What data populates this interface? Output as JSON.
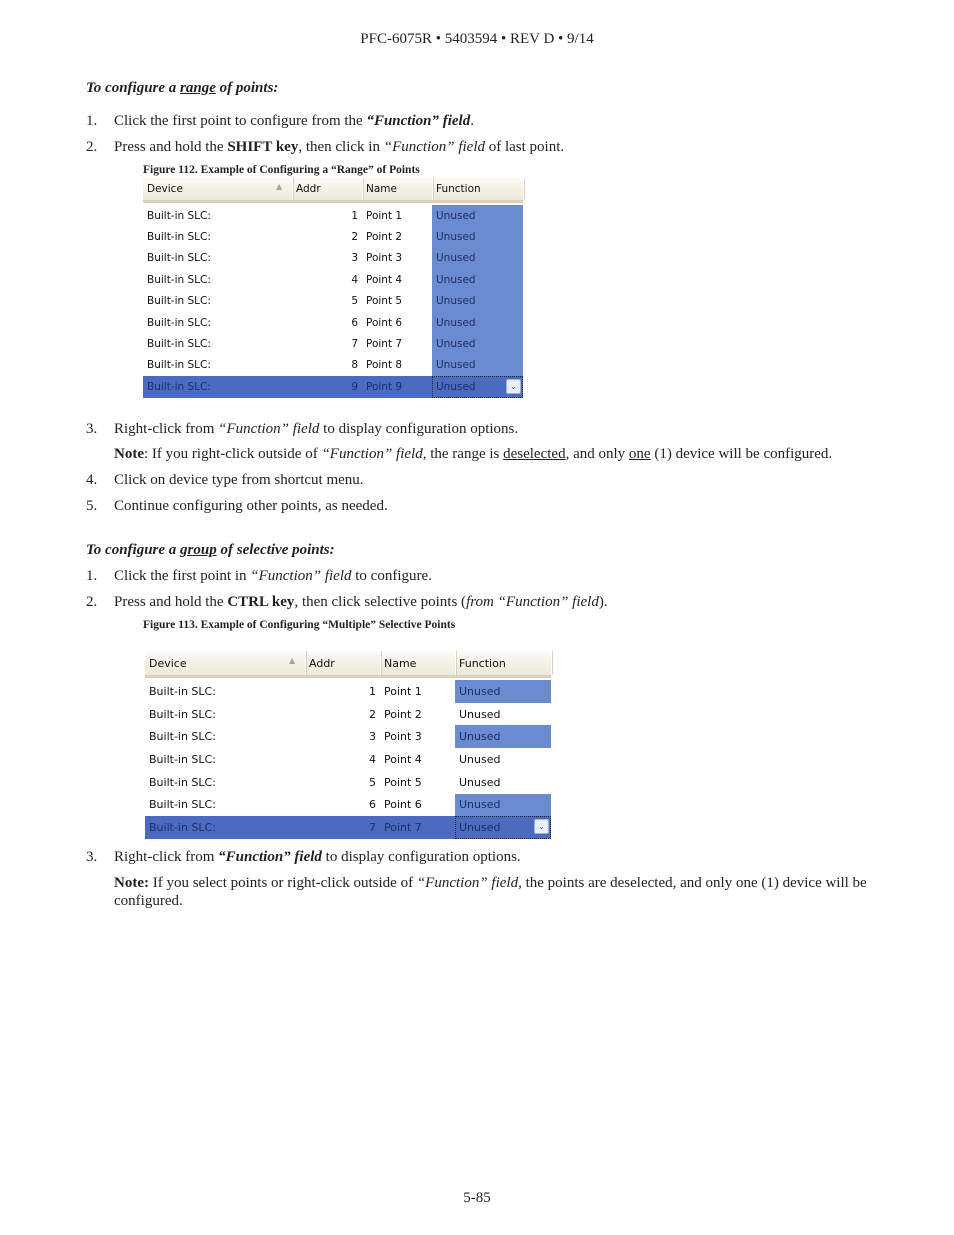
{
  "header": "PFC-6075R • 5403594 • REV D • 9/14",
  "footer": "5-85",
  "section1": {
    "heading": [
      {
        "t": "To configure a ",
        "s": "bi"
      },
      {
        "t": "range",
        "s": "biu"
      },
      {
        "t": " of points:",
        "s": "bi"
      }
    ],
    "steps": [
      {
        "n": "1.",
        "parts": [
          {
            "t": "Click the first point to configure from the ",
            "s": ""
          },
          {
            "t": "“Function” field",
            "s": "bi"
          },
          {
            "t": ".",
            "s": ""
          }
        ]
      },
      {
        "n": "2.",
        "parts": [
          {
            "t": "Press and hold the ",
            "s": ""
          },
          {
            "t": "SHIFT key",
            "s": "b"
          },
          {
            "t": ", then click in ",
            "s": ""
          },
          {
            "t": "“Function” field",
            "s": "i"
          },
          {
            "t": " of last point.",
            "s": ""
          }
        ]
      }
    ],
    "figure_caption": "Figure 112. Example of Configuring a “Range” of Points",
    "steps2": [
      {
        "n": "3.",
        "parts": [
          {
            "t": "Right-click from ",
            "s": ""
          },
          {
            "t": "“Function” field",
            "s": "i"
          },
          {
            "t": " to display configuration options.",
            "s": ""
          }
        ]
      },
      {
        "n": "",
        "parts": [
          {
            "t": "Note",
            "s": "b"
          },
          {
            "t": ": If you right-click outside of ",
            "s": ""
          },
          {
            "t": "“Function” field,",
            "s": "i"
          },
          {
            "t": " the range is ",
            "s": ""
          },
          {
            "t": "deselected",
            "s": "u"
          },
          {
            "t": ", and only ",
            "s": ""
          },
          {
            "t": "one",
            "s": "u"
          },
          {
            "t": " (1) device will be configured.",
            "s": ""
          }
        ]
      },
      {
        "n": "4.",
        "parts": [
          {
            "t": "Click on device type from shortcut menu.",
            "s": ""
          }
        ]
      },
      {
        "n": "5.",
        "parts": [
          {
            "t": "Continue configuring other points, as needed.",
            "s": ""
          }
        ]
      }
    ]
  },
  "section2": {
    "heading": [
      {
        "t": "To configure a ",
        "s": "bi"
      },
      {
        "t": "group",
        "s": "biu"
      },
      {
        "t": " of selective points:",
        "s": "bi"
      }
    ],
    "steps": [
      {
        "n": "1.",
        "parts": [
          {
            "t": "Click the first point in ",
            "s": ""
          },
          {
            "t": "“Function” field",
            "s": "i"
          },
          {
            "t": " to configure.",
            "s": ""
          }
        ]
      },
      {
        "n": "2.",
        "parts": [
          {
            "t": "Press and hold the ",
            "s": ""
          },
          {
            "t": "CTRL key",
            "s": "b"
          },
          {
            "t": ", then click selective points (",
            "s": ""
          },
          {
            "t": "from “Function” field",
            "s": "i"
          },
          {
            "t": ").",
            "s": ""
          }
        ]
      }
    ],
    "figure_caption": "Figure 113. Example of Configuring “Multiple” Selective Points",
    "steps2": [
      {
        "n": "3.",
        "parts": [
          {
            "t": "Right-click from ",
            "s": ""
          },
          {
            "t": "“Function” field",
            "s": "bi"
          },
          {
            "t": " to display configuration options.",
            "s": ""
          }
        ]
      }
    ],
    "note_line1": [
      {
        "t": "Note:",
        "s": "b"
      },
      {
        "t": " If you select points or right-click outside of ",
        "s": ""
      },
      {
        "t": "“Function” field,",
        "s": "i"
      },
      {
        "t": " the points are deselected, and only one (1) device will be",
        "s": ""
      }
    ],
    "note_line2": [
      {
        "t": "configured.",
        "s": ""
      }
    ]
  },
  "grid1": {
    "columns": [
      "Device",
      "Addr",
      "Name",
      "Function"
    ],
    "sort_icon": "triangle-up-icon",
    "rows": [
      {
        "device": "Built-in SLC:",
        "addr": "1",
        "name": "Point 1",
        "function": "Unused",
        "highlighted": true,
        "selected": false
      },
      {
        "device": "Built-in SLC:",
        "addr": "2",
        "name": "Point 2",
        "function": "Unused",
        "highlighted": true,
        "selected": false
      },
      {
        "device": "Built-in SLC:",
        "addr": "3",
        "name": "Point 3",
        "function": "Unused",
        "highlighted": true,
        "selected": false
      },
      {
        "device": "Built-in SLC:",
        "addr": "4",
        "name": "Point 4",
        "function": "Unused",
        "highlighted": true,
        "selected": false
      },
      {
        "device": "Built-in SLC:",
        "addr": "5",
        "name": "Point 5",
        "function": "Unused",
        "highlighted": true,
        "selected": false
      },
      {
        "device": "Built-in SLC:",
        "addr": "6",
        "name": "Point 6",
        "function": "Unused",
        "highlighted": true,
        "selected": false
      },
      {
        "device": "Built-in SLC:",
        "addr": "7",
        "name": "Point 7",
        "function": "Unused",
        "highlighted": true,
        "selected": false
      },
      {
        "device": "Built-in SLC:",
        "addr": "8",
        "name": "Point 8",
        "function": "Unused",
        "highlighted": true,
        "selected": false
      },
      {
        "device": "Built-in SLC:",
        "addr": "9",
        "name": "Point 9",
        "function": "Unused",
        "highlighted": true,
        "selected": true
      }
    ]
  },
  "grid2": {
    "columns": [
      "Device",
      "Addr",
      "Name",
      "Function"
    ],
    "sort_icon": "triangle-up-icon",
    "rows": [
      {
        "device": "Built-in SLC:",
        "addr": "1",
        "name": "Point 1",
        "function": "Unused",
        "highlighted": true,
        "selected": false
      },
      {
        "device": "Built-in SLC:",
        "addr": "2",
        "name": "Point 2",
        "function": "Unused",
        "highlighted": false,
        "selected": false
      },
      {
        "device": "Built-in SLC:",
        "addr": "3",
        "name": "Point 3",
        "function": "Unused",
        "highlighted": true,
        "selected": false
      },
      {
        "device": "Built-in SLC:",
        "addr": "4",
        "name": "Point 4",
        "function": "Unused",
        "highlighted": false,
        "selected": false
      },
      {
        "device": "Built-in SLC:",
        "addr": "5",
        "name": "Point 5",
        "function": "Unused",
        "highlighted": false,
        "selected": false
      },
      {
        "device": "Built-in SLC:",
        "addr": "6",
        "name": "Point 6",
        "function": "Unused",
        "highlighted": true,
        "selected": false
      },
      {
        "device": "Built-in SLC:",
        "addr": "7",
        "name": "Point 7",
        "function": "Unused",
        "highlighted": true,
        "selected": true
      }
    ]
  },
  "colors": {
    "selection_row": "#4a6bc0",
    "selection_cell": "#6b8bd0",
    "header_bg": "#ece9d8"
  }
}
